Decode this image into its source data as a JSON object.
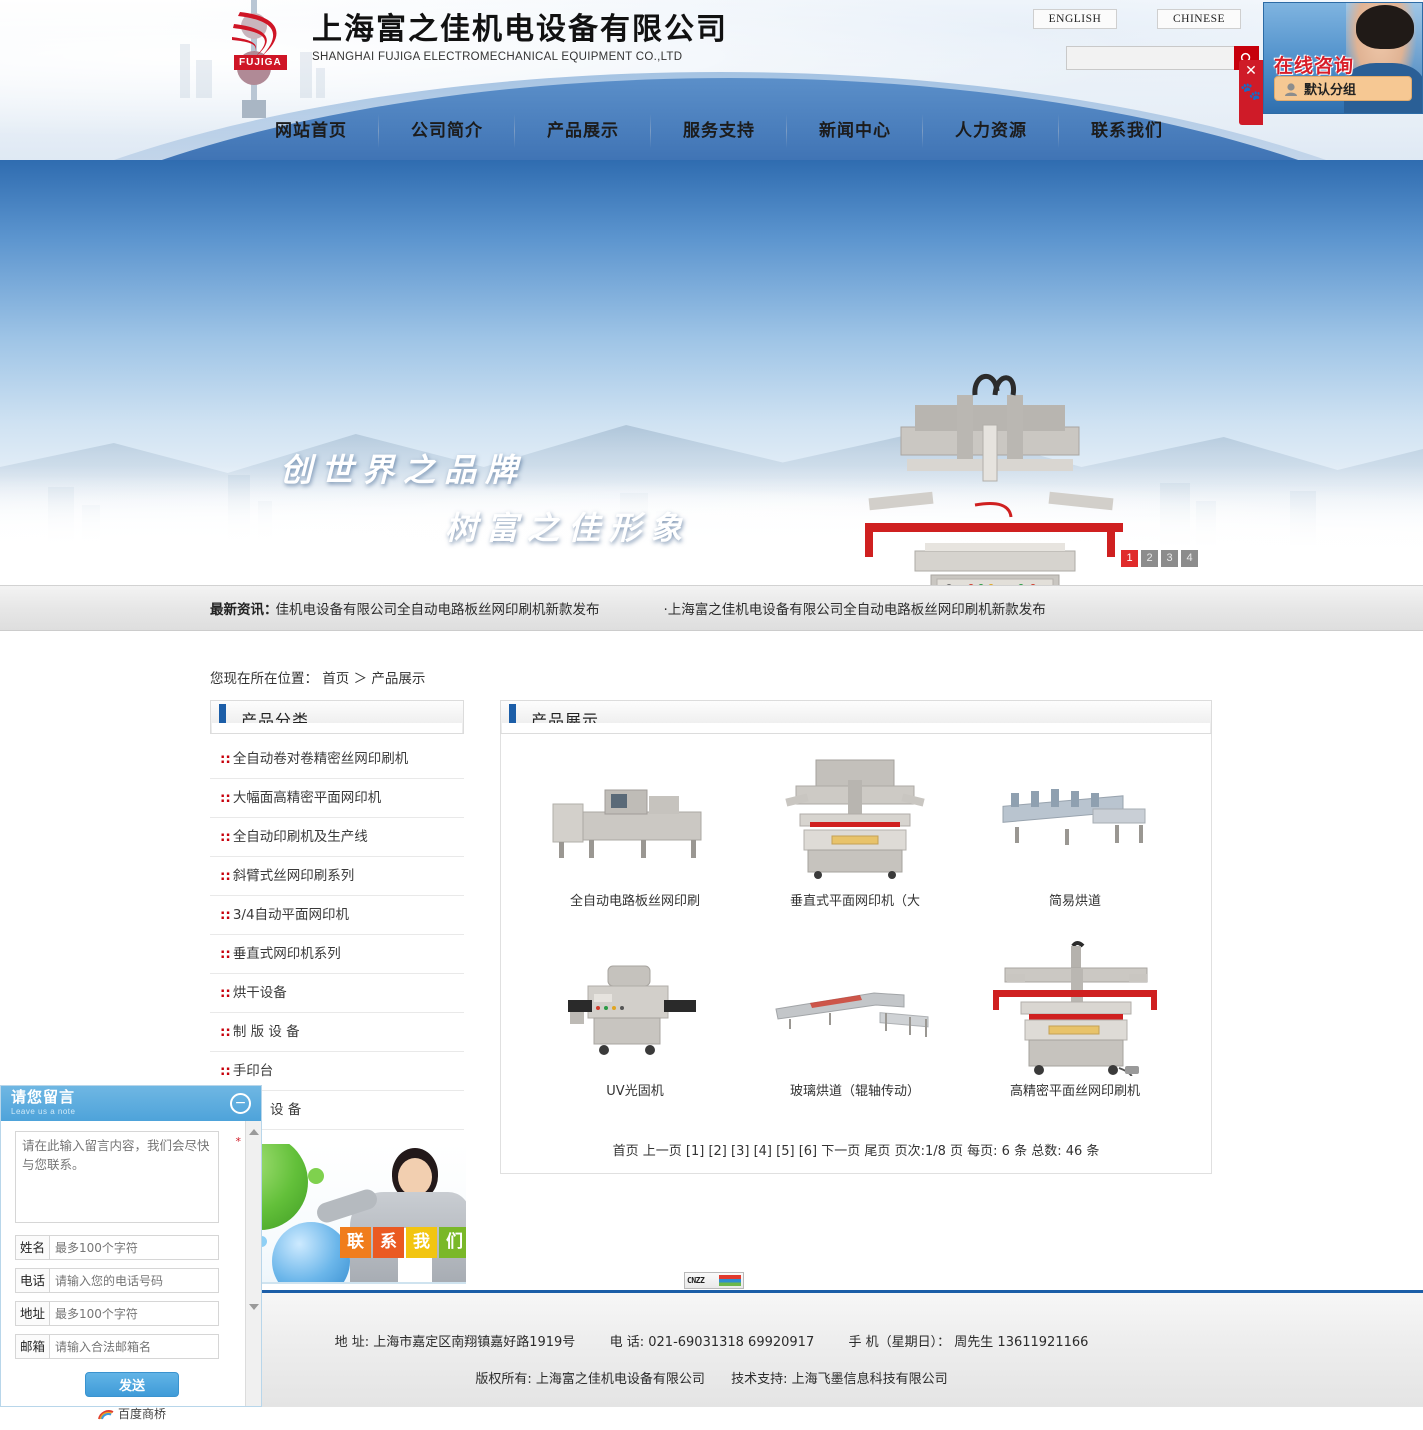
{
  "header": {
    "company_cn": "上海富之佳机电设备有限公司",
    "company_en": "SHANGHAI FUJIGA ELECTROMECHANICAL EQUIPMENT CO.,LTD",
    "logo_badge": "FUJIGA",
    "lang_english": "ENGLISH",
    "lang_chinese": "CHINESE",
    "search_value": "",
    "search_placeholder": ""
  },
  "consult": {
    "title": "在线咨询",
    "group_label": "默认分组"
  },
  "nav": {
    "items": [
      {
        "label": "网站首页"
      },
      {
        "label": "公司简介"
      },
      {
        "label": "产品展示"
      },
      {
        "label": "服务支持"
      },
      {
        "label": "新闻中心"
      },
      {
        "label": "人力资源"
      },
      {
        "label": "联系我们"
      }
    ]
  },
  "banner": {
    "slogan_line1": "创世界之品牌",
    "slogan_line2": "树富之佳形象",
    "dots": [
      "1",
      "2",
      "3",
      "4"
    ],
    "active_dot": "1"
  },
  "news": {
    "label": "最新资讯：",
    "item1": "佳机电设备有限公司全自动电路板丝网印刷机新款发布",
    "item2": "·上海富之佳机电设备有限公司全自动电路板丝网印刷机新款发布"
  },
  "breadcrumb": {
    "prefix": "您现在所在位置：",
    "home": "首页",
    "sep": "＞",
    "current": "产品展示"
  },
  "sidebar": {
    "panel_title": "产品分类",
    "categories": [
      {
        "label": "全自动卷对卷精密丝网印刷机"
      },
      {
        "label": "大幅面高精密平面网印机"
      },
      {
        "label": "全自动印刷机及生产线"
      },
      {
        "label": "斜臂式丝网印刷系列"
      },
      {
        "label": "3/4自动平面网印机"
      },
      {
        "label": "垂直式网印机系列"
      },
      {
        "label": "烘干设备"
      },
      {
        "label": "制 版 设 备"
      },
      {
        "label": "手印台"
      },
      {
        "label": "设 备"
      }
    ],
    "mark": "::",
    "contact_banner_words": [
      "联",
      "系",
      "我",
      "们"
    ]
  },
  "products": {
    "panel_title": "产品展示",
    "items": [
      {
        "name": "全自动电路板丝网印刷",
        "icon": "machine-line"
      },
      {
        "name": "垂直式平面网印机（大",
        "icon": "machine-vertical"
      },
      {
        "name": "简易烘道",
        "icon": "machine-dryer"
      },
      {
        "name": "UV光固机",
        "icon": "machine-uv"
      },
      {
        "name": "玻璃烘道（辊轴传动）",
        "icon": "machine-glass-dryer"
      },
      {
        "name": "高精密平面丝网印刷机",
        "icon": "machine-precision"
      }
    ],
    "pager": {
      "first": "首页",
      "prev": "上一页",
      "pages": [
        "[1]",
        "[2]",
        "[3]",
        "[4]",
        "[5]",
        "[6]"
      ],
      "next": "下一页",
      "last": "尾页",
      "page_info": "页次:1/8 页",
      "per_page": "每页: 6 条",
      "total": "总数: 46 条"
    }
  },
  "analytics": {
    "badge": "CNZZ"
  },
  "footer": {
    "address_label": "地 址:",
    "address": "上海市嘉定区南翔镇嘉好路1919号",
    "tel_label": "电 话:",
    "tel": "021-69031318 69920917",
    "mobile_label": "手 机（星期日）：",
    "mobile": "周先生 13611921166",
    "copyright_label": "版权所有:",
    "copyright": "上海富之佳机电设备有限公司",
    "support_label": "技术支持:",
    "support": "上海飞墨信息科技有限公司"
  },
  "note_widget": {
    "title": "请您留言",
    "subtitle": "Leave us a note",
    "message_placeholder": "请在此输入留言内容，我们会尽快与您联系。",
    "message_value": "",
    "required_mark": "*",
    "fields": [
      {
        "label": "姓名",
        "placeholder": "最多100个字符",
        "value": ""
      },
      {
        "label": "电话",
        "placeholder": "请输入您的电话号码",
        "value": ""
      },
      {
        "label": "地址",
        "placeholder": "最多100个字符",
        "value": ""
      },
      {
        "label": "邮箱",
        "placeholder": "请输入合法邮箱名",
        "value": ""
      }
    ],
    "send_label": "发送",
    "brand": "百度商桥"
  },
  "colors": {
    "brand_red": "#c7000b",
    "brand_blue": "#1c5ea8",
    "accent_orange": "#f6c893"
  }
}
